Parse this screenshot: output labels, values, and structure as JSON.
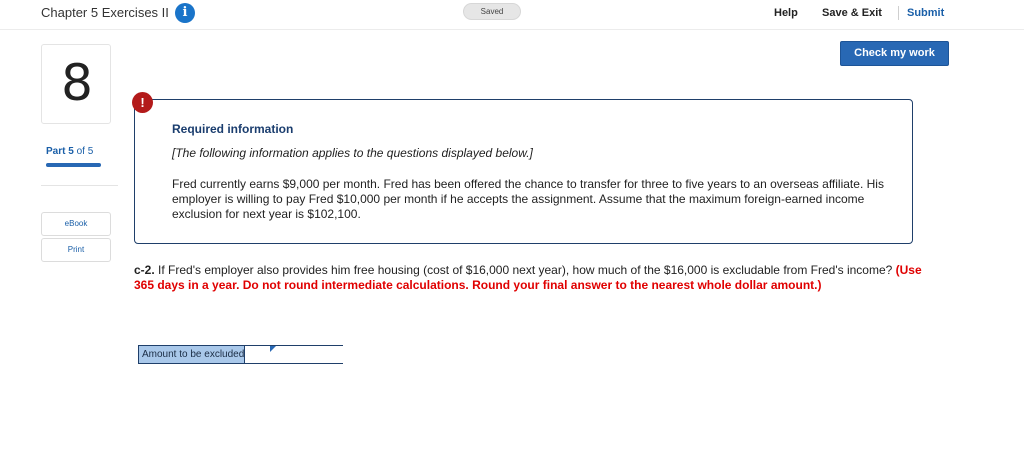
{
  "header": {
    "title": "Chapter 5 Exercises II",
    "info_icon": "info-icon",
    "saved_label": "Saved",
    "help_label": "Help",
    "save_exit_label": "Save & Exit",
    "submit_label": "Submit"
  },
  "check_button_label": "Check my work",
  "left_rail": {
    "question_number": "8",
    "part_prefix": "Part",
    "part_current": "5",
    "part_suffix": "of 5",
    "progress_fraction": 1.0,
    "ebook_label": "eBook",
    "print_label": "Print"
  },
  "required_info": {
    "alert_glyph": "!",
    "title": "Required information",
    "subtitle": "[The following information applies to the questions displayed below.]",
    "body": "Fred currently earns $9,000 per month. Fred has been offered the chance to transfer for three to five years to an overseas affiliate. His employer is willing to pay Fred $10,000 per month if he accepts the assignment. Assume that the maximum foreign-earned income exclusion for next year is $102,100."
  },
  "question": {
    "number": "c-2.",
    "text": " If Fred's employer also provides him free housing (cost of $16,000 next year), how much of the $16,000 is excludable from Fred's income? ",
    "instruction": "(Use 365 days in a year. Do not round intermediate calculations. Round your final answer to the nearest whole dollar amount.)"
  },
  "answer": {
    "label": "Amount to be excluded",
    "value": ""
  },
  "colors": {
    "accent_blue": "#2868b4",
    "alert_red": "#b31a1a",
    "instruction_red": "#e00000",
    "label_fill": "#a9c8ea"
  }
}
